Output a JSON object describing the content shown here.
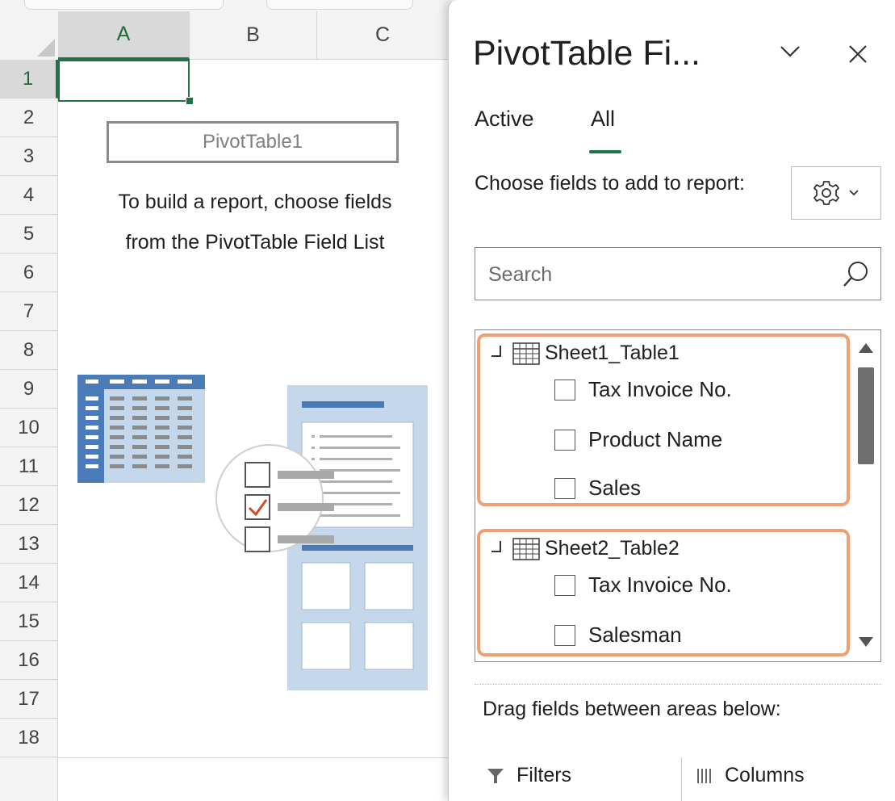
{
  "spreadsheet": {
    "columns": [
      "A",
      "B",
      "C"
    ],
    "rows": [
      "1",
      "2",
      "3",
      "4",
      "5",
      "6",
      "7",
      "8",
      "9",
      "10",
      "11",
      "12",
      "13",
      "14",
      "15",
      "16",
      "17",
      "18"
    ],
    "active_column": "A",
    "active_row": "1",
    "pivot_placeholder": "PivotTable1",
    "hint_line1": "To build a report, choose fields",
    "hint_line2": "from the PivotTable Field List"
  },
  "field_pane": {
    "title": "PivotTable Fi...",
    "tabs": [
      {
        "label": "Active",
        "selected": false
      },
      {
        "label": "All",
        "selected": true
      }
    ],
    "choose_label": "Choose fields to add to report:",
    "search_placeholder": "Search",
    "tables": [
      {
        "name": "Sheet1_Table1",
        "fields": [
          "Tax Invoice No.",
          "Product Name",
          "Sales"
        ]
      },
      {
        "name": "Sheet2_Table2",
        "fields": [
          "Tax Invoice No.",
          "Salesman"
        ]
      }
    ],
    "drag_label": "Drag fields between areas below:",
    "areas": [
      "Filters",
      "Columns"
    ]
  },
  "colors": {
    "excel_green": "#217346",
    "highlight_orange": "#f0a070",
    "illustration_blue": "#4a7ab8",
    "illustration_light_blue": "#c5d7ea",
    "check_red": "#d04a2a"
  },
  "icons": [
    "chevron-down-icon",
    "close-icon",
    "gear-icon",
    "search-icon",
    "table-icon",
    "filter-icon",
    "columns-icon"
  ]
}
